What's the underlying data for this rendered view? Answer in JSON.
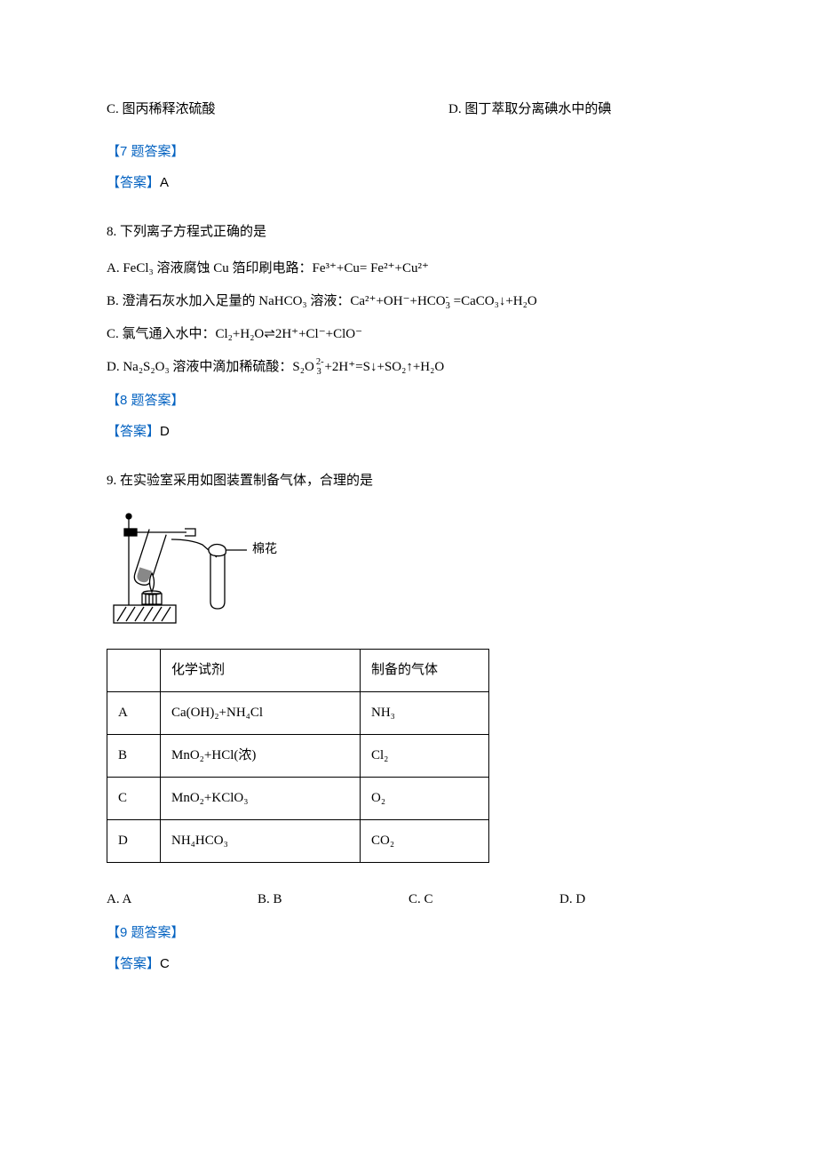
{
  "q7": {
    "optC": "C. 图丙稀释浓硫酸",
    "optD": "D. 图丁萃取分离碘水中的碘",
    "ansHeader": "【7 题答案】",
    "ansLabel": "【答案】",
    "ansValue": "A"
  },
  "q8": {
    "stem": "8. 下列离子方程式正确的是",
    "optA": "A. FeCl₃ 溶液腐蚀 Cu 箔印刷电路：Fe³⁺+Cu= Fe²⁺+Cu²⁺",
    "optB_pre": "B. 澄清石灰水加入足量的 NaHCO₃ 溶液：Ca²⁺+OH⁻+HCO",
    "optB_mid": "₃⁻",
    "optB_post": " =CaCO₃↓+H₂O",
    "optC": "C. 氯气通入水中：Cl₂+H₂O⇌2H⁺+Cl⁻+ClO⁻",
    "optD_pre": "D. Na₂S₂O₃ 溶液中滴加稀硫酸：S₂O",
    "optD_mid": "₃²⁻",
    "optD_post": " +2H⁺=S↓+SO₂↑+H₂O",
    "ansHeader": "【8 题答案】",
    "ansLabel": "【答案】",
    "ansValue": "D"
  },
  "q9": {
    "stem": "9. 在实验室采用如图装置制备气体，合理的是",
    "apparatusLabel": "棉花",
    "table": {
      "headers": [
        "",
        "化学试剂",
        "制备的气体"
      ],
      "rows": [
        [
          "A",
          "Ca(OH)₂+NH₄Cl",
          "NH₃"
        ],
        [
          "B",
          "MnO₂+HCl(浓)",
          "Cl₂"
        ],
        [
          "C",
          "MnO₂+KClO₃",
          "O₂"
        ],
        [
          "D",
          "NH₄HCO₃",
          "CO₂"
        ]
      ]
    },
    "options": [
      "A. A",
      "B. B",
      "C. C",
      "D. D"
    ],
    "ansHeader": "【9 题答案】",
    "ansLabel": "【答案】",
    "ansValue": "C"
  }
}
